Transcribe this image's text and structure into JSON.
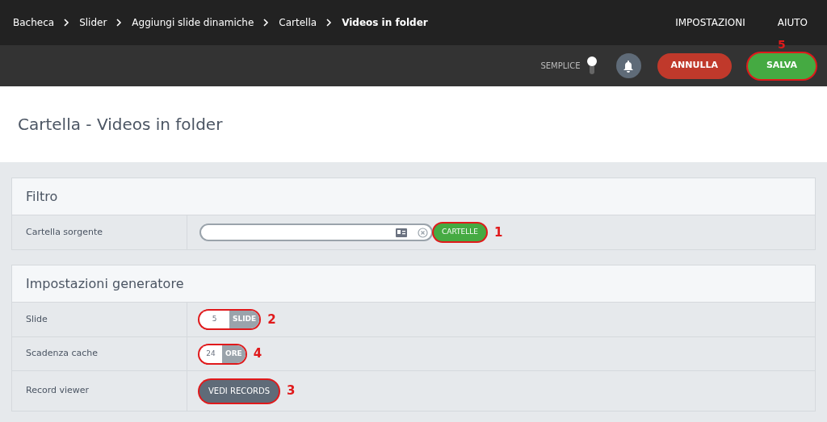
{
  "breadcrumb": [
    {
      "label": "Bacheca",
      "current": false
    },
    {
      "label": "Slider",
      "current": false
    },
    {
      "label": "Aggiungi slide dinamiche",
      "current": false
    },
    {
      "label": "Cartella",
      "current": false
    },
    {
      "label": "Videos in folder",
      "current": true
    }
  ],
  "top_menu": [
    "IMPOSTAZIONI",
    "AIUTO"
  ],
  "toolbar": {
    "mode_toggle": {
      "label": "SEMPLICE",
      "on": true
    },
    "cancel_button": "ANNULLA",
    "save_button": {
      "label": "SALVA",
      "marker": "5"
    }
  },
  "page_title": "Cartella - Videos in folder",
  "panels": [
    {
      "title": "Filtro",
      "rows": [
        {
          "kind": "folder",
          "label": "Cartella sorgente",
          "button": "CARTELLE",
          "marker": "1"
        }
      ]
    },
    {
      "title": "Impostazioni generatore",
      "rows": [
        {
          "kind": "number",
          "label": "Slide",
          "value": "5",
          "unit": "SLIDE",
          "marker": "2"
        },
        {
          "kind": "number",
          "label": "Scadenza cache",
          "value": "24",
          "unit": "ORE",
          "marker": "4"
        },
        {
          "kind": "button",
          "label": "Record viewer",
          "button": "VEDI RECORDS",
          "marker": "3"
        }
      ]
    }
  ]
}
